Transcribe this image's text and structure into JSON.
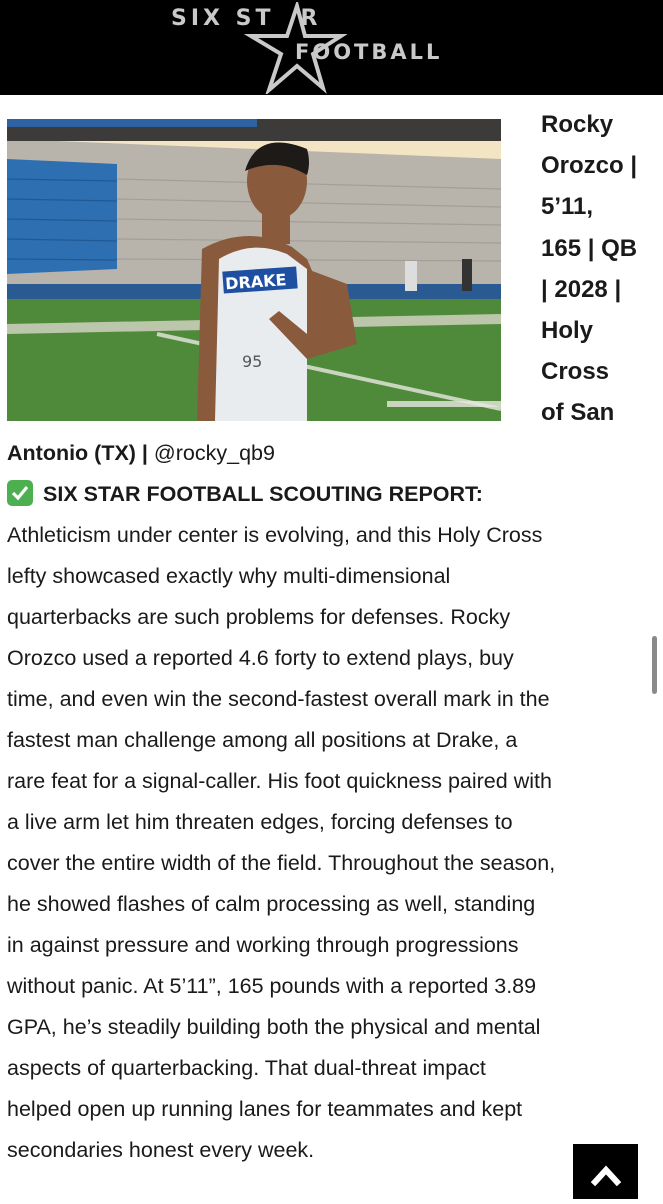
{
  "header": {
    "logo_line1": "SIX ST",
    "logo_line1_r": "R",
    "logo_line2": "FOOTBALL"
  },
  "photo": {
    "jersey_text": "DRAKE",
    "number_text": "95"
  },
  "title_lines": [
    "Rocky",
    "Orozco |",
    "5’11,",
    "165 | QB",
    "| 2028 |",
    "Holy",
    "Cross",
    "of San"
  ],
  "title_continued": "Antonio (TX) |",
  "handle": " @rocky_qb9",
  "report_heading": "SIX STAR FOOTBALL SCOUTING REPORT:",
  "body_lines": [
    "Athleticism under center is evolving, and this Holy Cross",
    "lefty showcased exactly why multi-dimensional",
    "quarterbacks are such problems for defenses. Rocky",
    "Orozco used a reported 4.6 forty to extend plays, buy",
    "time, and even win the second-fastest overall mark in the",
    "fastest man challenge among all positions at Drake, a",
    "rare feat for a signal-caller. His foot quickness paired with",
    "a live arm let him threaten edges, forcing defenses to",
    "cover the entire width of the field. Throughout the season,",
    "he showed flashes of calm processing as well, standing",
    "in against pressure and working through progressions",
    "without panic. At 5’11”, 165 pounds with a reported 3.89",
    "GPA, he’s steadily building both the physical and mental",
    "aspects of quarterbacking. That dual-threat impact",
    "helped open up running lanes for teammates and kept",
    "secondaries honest every week."
  ],
  "icons": {
    "check": "check-mark-icon",
    "scroll_top": "chevron-up-icon"
  },
  "colors": {
    "header_bg": "#000000",
    "logo": "#c9c9c9",
    "check_bg": "#4caf50",
    "text": "#1a1a1a"
  }
}
